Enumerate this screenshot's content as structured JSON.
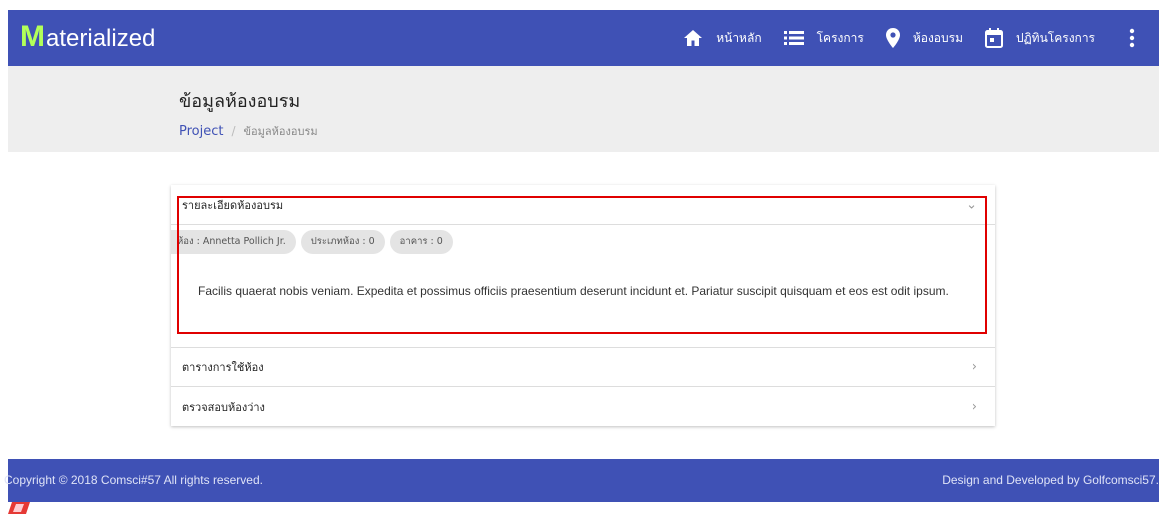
{
  "navbar": {
    "brand_initial": "M",
    "brand_rest": "aterialized",
    "items": [
      {
        "label": "หน้าหลัก",
        "icon": "home-icon"
      },
      {
        "label": "โครงการ",
        "icon": "list-icon"
      },
      {
        "label": "ห้องอบรม",
        "icon": "location-pin-icon"
      },
      {
        "label": "ปฏิทินโครงการ",
        "icon": "calendar-icon"
      }
    ],
    "more_icon": "more-vertical-icon",
    "color": "#3f51b5",
    "brand_accent": "#b2ff59"
  },
  "header": {
    "title": "ข้อมูลห้องอบรม",
    "breadcrumb": {
      "link": "Project",
      "separator": "/",
      "current": "ข้อมูลห้องอบรม"
    }
  },
  "sections": [
    {
      "label": "รายละเอียดห้องอบรม",
      "expanded": true,
      "chips": [
        "ห้อง : Annetta Pollich Jr.",
        "ประเภทห้อง : 0",
        "อาคาร : 0"
      ],
      "description": "Facilis quaerat nobis veniam. Expedita et possimus officiis praesentium deserunt incidunt et. Pariatur suscipit quisquam et eos est odit ipsum."
    },
    {
      "label": "ตารางการใช้ห้อง",
      "expanded": false
    },
    {
      "label": "ตรวจสอบห้องว่าง",
      "expanded": false
    }
  ],
  "footer": {
    "left": "Copyright © 2018 Comsci#57 All rights reserved.",
    "right": "Design and Developed by Golfcomsci57."
  },
  "highlight_color": "#e00000"
}
